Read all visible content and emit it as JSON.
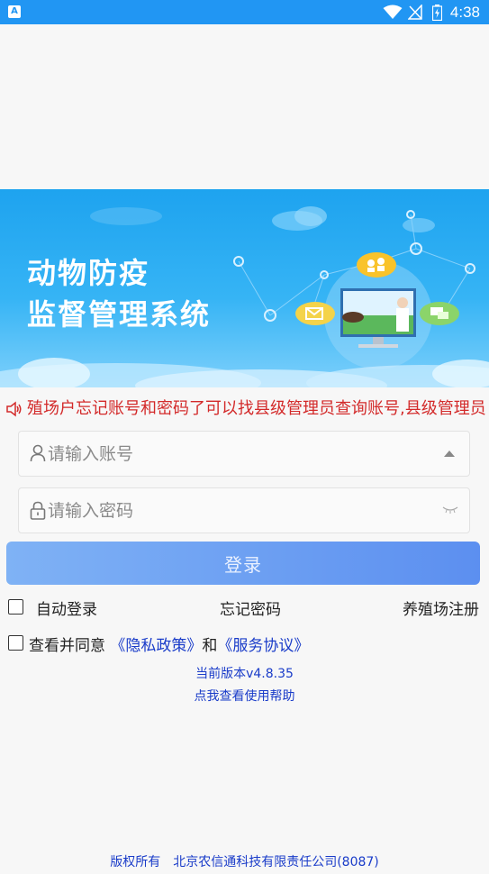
{
  "status_bar": {
    "time": "4:38",
    "icons": [
      "wifi-icon",
      "no-signal-icon",
      "battery-charging-icon"
    ],
    "color": "#2196f3"
  },
  "banner": {
    "title_line1": "动物防疫",
    "title_line2": "监督管理系统"
  },
  "notice": {
    "text": "殖场户忘记账号和密码了可以找县级管理员查询账号,县级管理员忘"
  },
  "form": {
    "account_placeholder": "请输入账号",
    "password_placeholder": "请输入密码",
    "login_label": "登录",
    "auto_login_label": "自动登录",
    "forgot_password_label": "忘记密码",
    "register_label": "养殖场注册",
    "agree_prefix": "查看并同意",
    "privacy_link": "《隐私政策》",
    "and_text": "和",
    "service_link": "《服务协议》"
  },
  "version_text": "当前版本v4.8.35",
  "help_text": "点我查看使用帮助",
  "footer": {
    "rights": "版权所有",
    "company": "北京农信通科技有限责任公司(8087)"
  },
  "colors": {
    "accent_blue": "#1a3cc9",
    "notice_red": "#d32a2a",
    "button_start": "#7fb2f5",
    "button_end": "#5c8ff0"
  }
}
